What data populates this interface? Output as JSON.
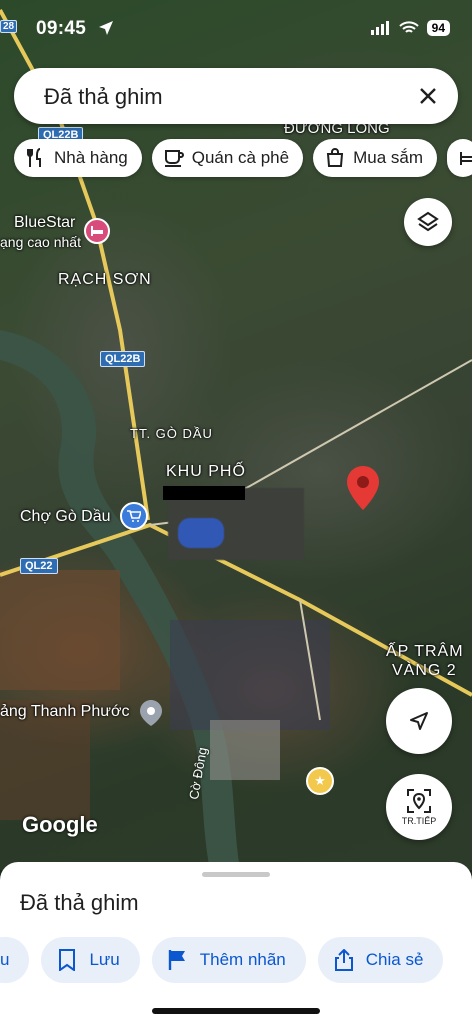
{
  "status_bar": {
    "time": "09:45",
    "battery": "94"
  },
  "search": {
    "text": "Đã thả ghim"
  },
  "chips": [
    {
      "label": "Nhà hàng",
      "icon": "fork-knife-icon"
    },
    {
      "label": "Quán cà phê",
      "icon": "coffee-icon"
    },
    {
      "label": "Mua sắm",
      "icon": "shopping-bag-icon"
    }
  ],
  "map": {
    "labels": {
      "duong_long": "ĐƯỜNG LONG",
      "bluestar": "BlueStar",
      "bluestar_sub": "ạng cao nhất",
      "rach_son": "RẠCH SƠN",
      "tt_go_dau": "TT. GÒ DẦU",
      "khu_pho": "KHU PHỐ",
      "cho_go_dau": "Chợ Gò Dầu",
      "ap_tram": "ẤP TRÂM",
      "vang2": "VÀNG 2",
      "thanh_phuoc": "ảng Thanh Phước",
      "river": "Cờ Đông"
    },
    "road_tags": {
      "ql22b_top": "QL22B",
      "ql22b_mid": "QL22B",
      "ql22": "QL22",
      "r28": "28"
    },
    "attribution": "Google",
    "directions_label": "TR.TIẾP",
    "pin_color": "#e53935"
  },
  "sheet": {
    "title": "Đã thả ghim",
    "actions": [
      {
        "label": "u",
        "icon": "partial-icon"
      },
      {
        "label": "Lưu",
        "icon": "bookmark-icon"
      },
      {
        "label": "Thêm nhãn",
        "icon": "flag-icon"
      },
      {
        "label": "Chia sẻ",
        "icon": "share-icon"
      }
    ]
  }
}
